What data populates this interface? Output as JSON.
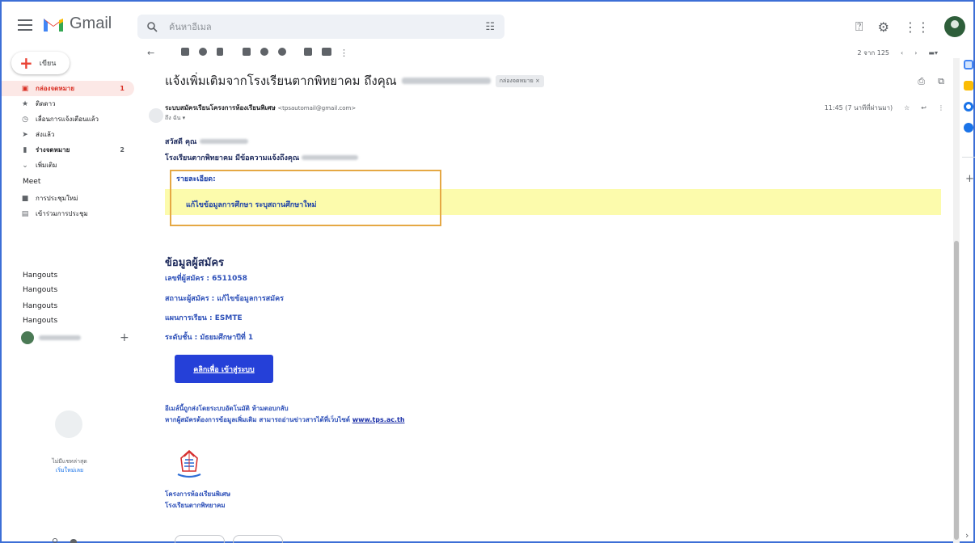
{
  "app": {
    "name": "Gmail"
  },
  "search": {
    "placeholder": "ค้นหาอีเมล"
  },
  "sidebar": {
    "compose_label": "เขียน",
    "items": [
      {
        "label": "กล่องจดหมาย",
        "count": "1",
        "icon": "inbox-icon"
      },
      {
        "label": "ติดดาว",
        "count": "",
        "icon": "star-icon"
      },
      {
        "label": "เลื่อนการแจ้งเตือนแล้ว",
        "count": "",
        "icon": "clock-icon"
      },
      {
        "label": "ส่งแล้ว",
        "count": "",
        "icon": "send-icon"
      },
      {
        "label": "ร่างจดหมาย",
        "count": "2",
        "icon": "draft-icon"
      },
      {
        "label": "เพิ่มเติม",
        "count": "",
        "icon": "chevron-down-icon"
      }
    ],
    "meet_heading": "Meet",
    "meet_items": [
      {
        "label": "การประชุมใหม่",
        "icon": "video-icon"
      },
      {
        "label": "เข้าร่วมการประชุม",
        "icon": "keyboard-icon"
      }
    ],
    "hangouts": [
      "Hangouts",
      "Hangouts",
      "Hangouts",
      "Hangouts"
    ],
    "no_chat": "ไม่มีแชทล่าสุด",
    "start_chat": "เริ่มใหม่เลย"
  },
  "toolbar": {
    "pager": "2 จาก 125"
  },
  "email": {
    "subject": "แจ้งเพิ่มเติมจากโรงเรียนตากพิทยาคม ถึงคุณ",
    "label_chip": "กล่องจดหมาย ×",
    "sender_name": "ระบบสมัครเรียนโครงการห้องเรียนพิเศษ",
    "sender_email": "<tpsautomail@gmail.com>",
    "to": "ถึง ฉัน ▾",
    "time": "11:45 (7 นาทีที่ผ่านมา)",
    "greeting": "สวัสดี คุณ",
    "intro": "โรงเรียนตากพิทยาคม มีข้อความแจ้งถึงคุณ",
    "details_heading": "รายละเอียด:",
    "details_item": "แก้ไขข้อมูลการศึกษา ระบุสถานศึกษาใหม่",
    "applicant_heading": "ข้อมูลผู้สมัคร",
    "applicant_lines": [
      "เลขที่ผู้สมัคร : 6511058",
      "สถานะผู้สมัคร : แก้ไขข้อมูลการสมัคร",
      "แผนการเรียน : ESMTE",
      "ระดับชั้น : มัธยมศึกษาปีที่ 1"
    ],
    "login_button": "คลิกเพื่อ เข้าสู่ระบบ",
    "footer_line1": "อีเมล์นี้ถูกส่งโดยระบบอัตโนมัติ ห้ามตอบกลับ",
    "footer_line2_prefix": "หากผู้สมัครต้องการข้อมูลเพิ่มเติม สามารถอ่านข่าวสารได้ที่เว็บไซต์ ",
    "footer_link": "www.tps.ac.th",
    "org_line1": "โครงการห้องเรียนพิเศษ",
    "org_line2": "โรงเรียนตากพิทยาคม"
  },
  "colors": {
    "accent": "#2540d8",
    "highlight": "#fcfbac",
    "box_border": "#e5a844",
    "gmail_red": "#ea4335"
  }
}
